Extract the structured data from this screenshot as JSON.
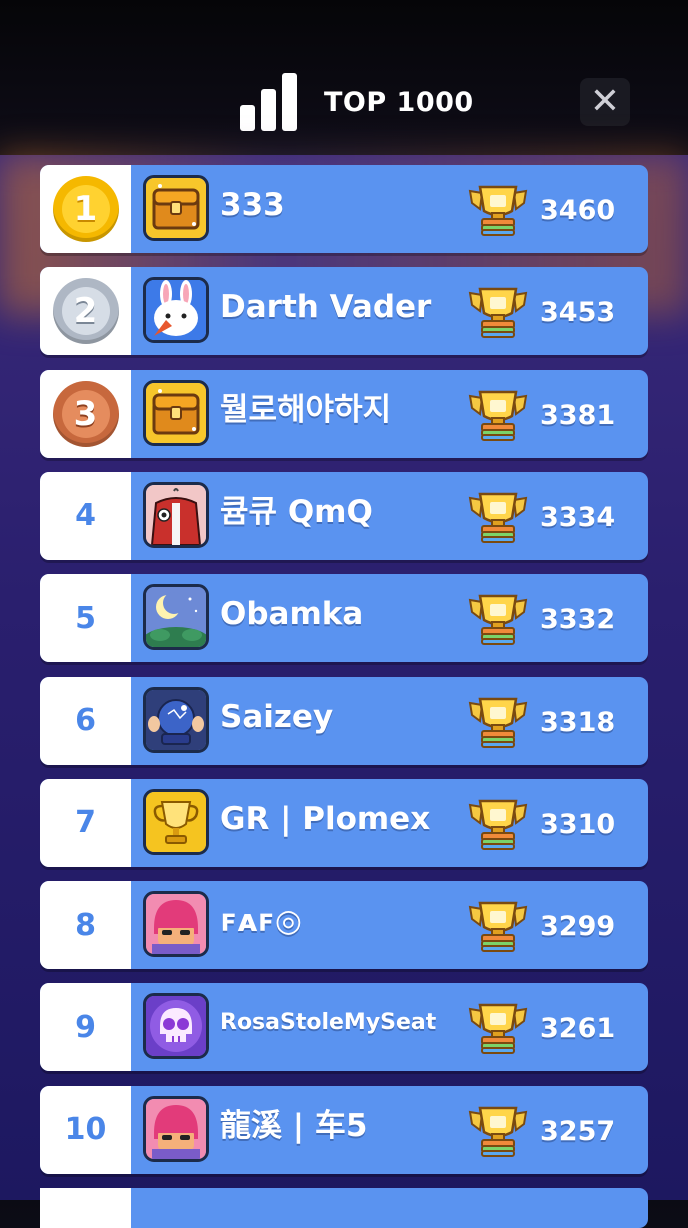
{
  "header": {
    "title": "TOP 1000",
    "close_label": "✕",
    "icon": "leaderboard-bars-icon"
  },
  "rows": [
    {
      "rank": "1",
      "medal": "gold",
      "name": "333",
      "score": "3460",
      "avatar": "chest-avatar"
    },
    {
      "rank": "2",
      "medal": "silver",
      "name": "Darth Vader",
      "score": "3453",
      "avatar": "bunny-avatar"
    },
    {
      "rank": "3",
      "medal": "bronze",
      "name": "뭘로해야하지",
      "score": "3381",
      "avatar": "chest-avatar"
    },
    {
      "rank": "4",
      "medal": "",
      "name": "큠큐 QmQ",
      "score": "3334",
      "avatar": "jacket-avatar"
    },
    {
      "rank": "5",
      "medal": "",
      "name": "Obamka",
      "score": "3332",
      "avatar": "moon-night-avatar"
    },
    {
      "rank": "6",
      "medal": "",
      "name": "Saizey",
      "score": "3318",
      "avatar": "crystal-ball-avatar"
    },
    {
      "rank": "7",
      "medal": "",
      "name": "GR | Plomex",
      "score": "3310",
      "avatar": "gold-cup-avatar"
    },
    {
      "rank": "8",
      "medal": "",
      "name": "ꜰᴀꜰ◎",
      "score": "3299",
      "avatar": "pink-hair-avatar"
    },
    {
      "rank": "9",
      "medal": "",
      "name": "RosaStoleMySeat",
      "score": "3261",
      "avatar": "skull-avatar"
    },
    {
      "rank": "10",
      "medal": "",
      "name": "龍溪 | 车5",
      "score": "3257",
      "avatar": "pink-hair-avatar"
    }
  ],
  "colors": {
    "row_blue": "#5a93f0",
    "rank_text": "#4a86e8"
  }
}
